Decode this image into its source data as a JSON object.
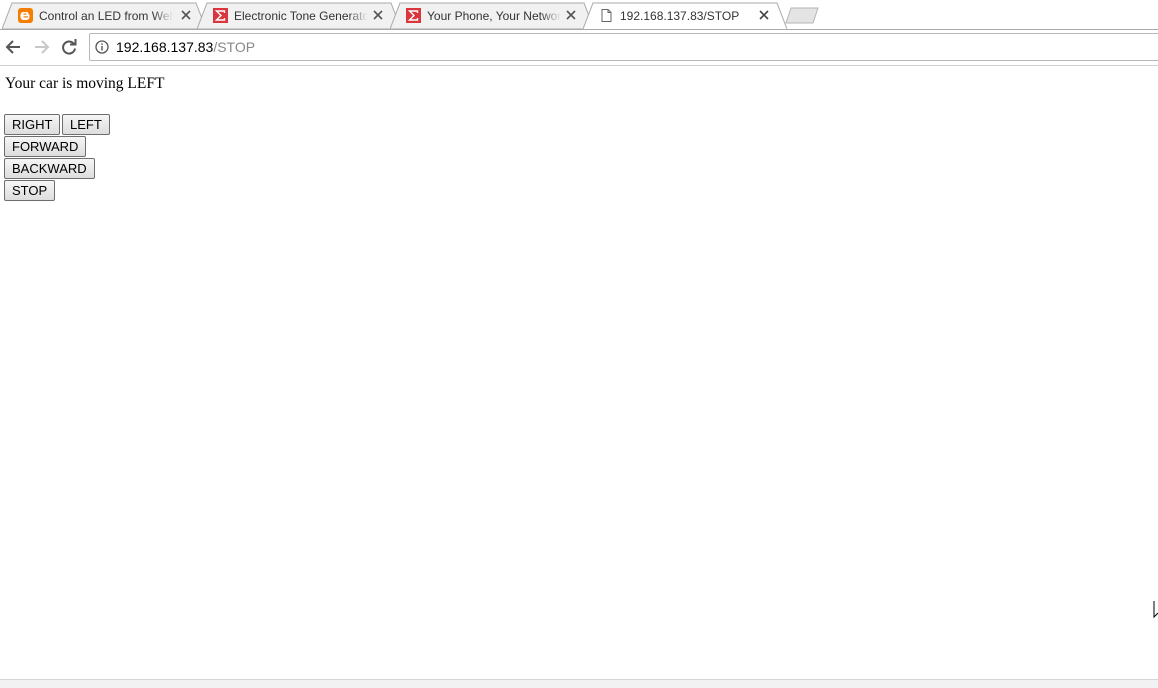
{
  "browser": {
    "tabs": [
      {
        "title": "Control an LED from Web",
        "favicon": "blogger-icon",
        "active": false
      },
      {
        "title": "Electronic Tone Generator",
        "favicon": "sigma-icon",
        "active": false
      },
      {
        "title": "Your Phone, Your Network",
        "favicon": "sigma-icon",
        "active": false
      },
      {
        "title": "192.168.137.83/STOP",
        "favicon": "page-icon",
        "active": true
      }
    ],
    "toolbar": {
      "back_icon": "arrow-left-icon",
      "forward_icon": "arrow-right-icon",
      "reload_icon": "reload-icon",
      "info_icon": "info-icon"
    },
    "address": {
      "host": "192.168.137.83",
      "path": "/STOP"
    },
    "colors": {
      "blogger": "#f57d00",
      "sigma": "#d9363e"
    }
  },
  "page": {
    "status_text": "Your car is moving LEFT",
    "buttons": {
      "right": "RIGHT",
      "left": "LEFT",
      "forward": "FORWARD",
      "backward": "BACKWARD",
      "stop": "STOP"
    }
  }
}
